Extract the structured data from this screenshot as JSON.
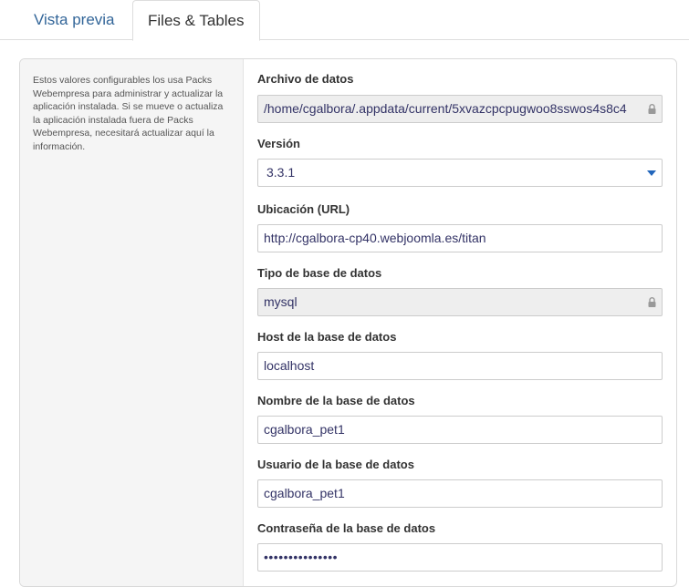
{
  "tabs": [
    {
      "label": "Vista previa"
    },
    {
      "label": "Files & Tables"
    }
  ],
  "sidebar": {
    "description": "Estos valores configurables los usa Packs Webempresa para administrar y actualizar la aplicación instalada. Si se mueve o actualiza la aplicación instalada fuera de Packs Webempresa, necesitará actualizar aquí la información."
  },
  "form": {
    "data_file": {
      "label": "Archivo de datos",
      "value": "/home/cgalbora/.appdata/current/5xvazcpcpugwoo8sswos4s8c4"
    },
    "version": {
      "label": "Versión",
      "value": "3.3.1"
    },
    "url": {
      "label": "Ubicación (URL)",
      "value": "http://cgalbora-cp40.webjoomla.es/titan"
    },
    "db_type": {
      "label": "Tipo de base de datos",
      "value": "mysql"
    },
    "db_host": {
      "label": "Host de la base de datos",
      "value": "localhost"
    },
    "db_name": {
      "label": "Nombre de la base de datos",
      "value": "cgalbora_pet1"
    },
    "db_user": {
      "label": "Usuario de la base de datos",
      "value": "cgalbora_pet1"
    },
    "db_password": {
      "label": "Contraseña de la base de datos",
      "value": "•••••••••••••••"
    }
  },
  "icons": {
    "lock": "lock-icon",
    "caret": "chevron-down-icon"
  },
  "colors": {
    "tab_link": "#336699",
    "readonly_bg": "#eeeeee",
    "caret": "#2266bb"
  }
}
